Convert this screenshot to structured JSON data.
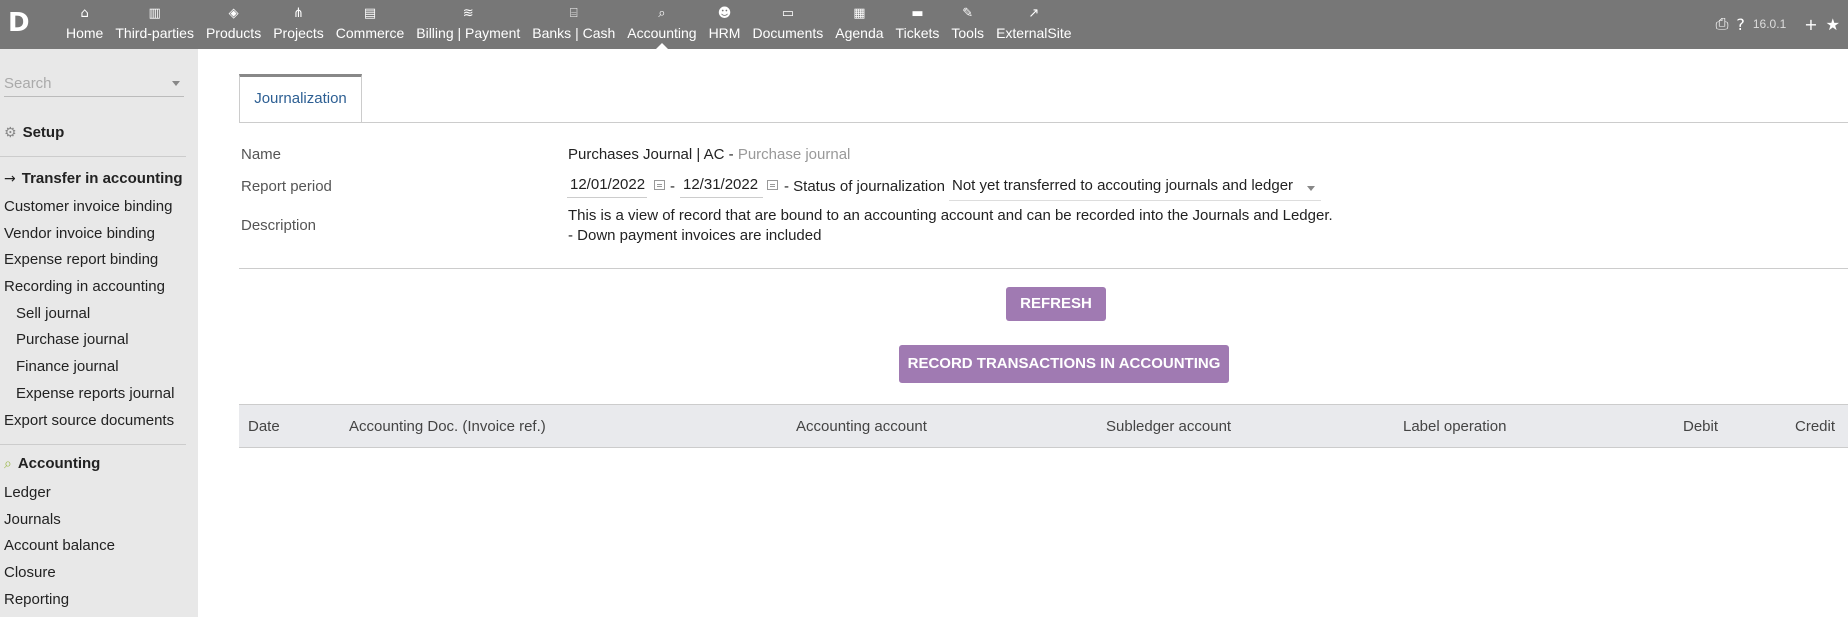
{
  "app": {
    "logo": "D",
    "version": "16.0.1"
  },
  "nav": [
    {
      "label": "Home",
      "icon": "⌂",
      "icon_name": "home-icon"
    },
    {
      "label": "Third-parties",
      "icon": "▥",
      "icon_name": "building-icon"
    },
    {
      "label": "Products",
      "icon": "◈",
      "icon_name": "cube-icon"
    },
    {
      "label": "Projects",
      "icon": "⋔",
      "icon_name": "sitemap-icon"
    },
    {
      "label": "Commerce",
      "icon": "▤",
      "icon_name": "briefcase-icon"
    },
    {
      "label": "Billing | Payment",
      "icon": "≋",
      "icon_name": "coins-icon"
    },
    {
      "label": "Banks | Cash",
      "icon": "⌸",
      "icon_name": "bank-icon"
    },
    {
      "label": "Accounting",
      "icon": "⌕",
      "icon_name": "search-dollar-icon"
    },
    {
      "label": "HRM",
      "icon": "☻",
      "icon_name": "user-tie-icon"
    },
    {
      "label": "Documents",
      "icon": "▭",
      "icon_name": "folder-icon"
    },
    {
      "label": "Agenda",
      "icon": "▦",
      "icon_name": "calendar-icon"
    },
    {
      "label": "Tickets",
      "icon": "▬",
      "icon_name": "ticket-icon"
    },
    {
      "label": "Tools",
      "icon": "✎",
      "icon_name": "wrench-icon"
    },
    {
      "label": "ExternalSite",
      "icon": "↗",
      "icon_name": "external-link-icon"
    }
  ],
  "active_nav": "Accounting",
  "tools": {
    "print_icon": "⎙",
    "help_icon": "?",
    "add_icon": "+",
    "bookmark_icon": "★"
  },
  "sidebar": {
    "search_placeholder": "Search",
    "setup_label": "Setup",
    "transfer_label": "Transfer in accounting",
    "transfer_links": [
      "Customer invoice binding",
      "Vendor invoice binding",
      "Expense report binding",
      "Recording in accounting"
    ],
    "journal_links": [
      "Sell journal",
      "Purchase journal",
      "Finance journal",
      "Expense reports journal"
    ],
    "export_link": "Export source documents",
    "accounting_label": "Accounting",
    "accounting_links": [
      "Ledger",
      "Journals",
      "Account balance",
      "Closure",
      "Reporting"
    ]
  },
  "main": {
    "tab_label": "Journalization",
    "name_label": "Name",
    "name_value": "Purchases Journal | AC - ",
    "name_type": "Purchase journal",
    "period_label": "Report period",
    "date_start": "12/01/2022",
    "date_sep": "-",
    "date_end": "12/31/2022",
    "status_label": "- Status of journalization",
    "status_value": "Not yet transferred to accouting journals and ledger",
    "description_label": "Description",
    "description_line1": "This is a view of record that are bound to an accounting account and can be recorded into the Journals and Ledger.",
    "description_line2": "- Down payment invoices are included",
    "refresh_button": "REFRESH",
    "record_button": "RECORD TRANSACTIONS IN ACCOUNTING",
    "columns": [
      "Date",
      "Accounting Doc. (Invoice ref.)",
      "Accounting account",
      "Subledger account",
      "Label operation",
      "Debit",
      "Credit"
    ]
  },
  "colors": {
    "topbar": "#777777",
    "sidebar": "#e8e8e8",
    "accent_button": "#a07ab2",
    "link": "#2d5f93"
  }
}
